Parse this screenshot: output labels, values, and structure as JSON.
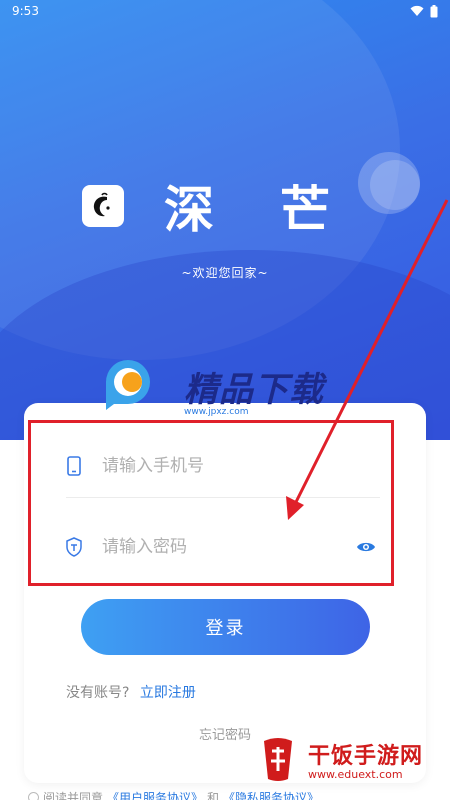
{
  "status_bar": {
    "time": "9:53"
  },
  "app": {
    "name": "深芒",
    "tagline": "~欢迎您回家~"
  },
  "form": {
    "phone_placeholder": "请输入手机号",
    "password_placeholder": "请输入密码",
    "login_label": "登录",
    "no_account": "没有账号?",
    "register_link": "立即注册",
    "forgot_password": "忘记密码"
  },
  "agreement": {
    "prefix": "阅读并同意",
    "user_agreement": "《用户服务协议》",
    "and": "和",
    "privacy_agreement": "《隐私服务协议》"
  },
  "watermarks": {
    "top_title": "精品下载",
    "top_url": "www.jpxz.com",
    "bottom_title": "干饭手游网",
    "bottom_url": "www.eduext.com"
  },
  "colors": {
    "accent": "#2a7ae0",
    "hero_start": "#2f8cf0",
    "hero_end": "#3656e0",
    "highlight_red": "#e0202a"
  }
}
